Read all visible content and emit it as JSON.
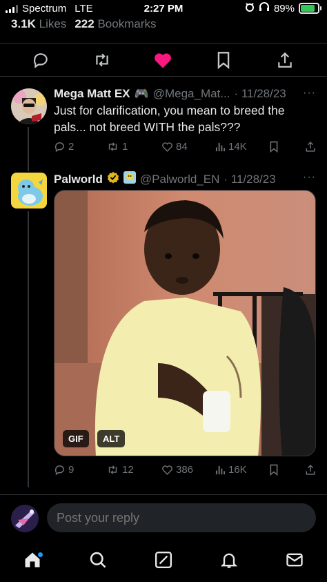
{
  "status_bar": {
    "carrier": "Spectrum",
    "network": "LTE",
    "time": "2:27 PM",
    "battery": "89%"
  },
  "stats": {
    "likes_count": "3.1K",
    "likes_label": "Likes",
    "bookmarks_count": "222",
    "bookmarks_label": "Bookmarks"
  },
  "actions": [
    "reply-icon",
    "retweet-icon",
    "heart-icon",
    "bookmark-icon",
    "share-icon"
  ],
  "accent": {
    "like": "#f91880",
    "link": "#1d9bf0",
    "verified": "#e2b719"
  },
  "tweets": [
    {
      "name": "Mega Matt EX",
      "name_emoji": "🎮",
      "handle": "@Mega_Mat...",
      "date": "· 11/28/23",
      "more": "···",
      "text": "Just for clarification, you mean to breed the pals... not breed WITH the pals???",
      "replies": "2",
      "retweets": "1",
      "likes": "84",
      "views": "14K"
    },
    {
      "name": "Palworld",
      "handle": "@Palworld_EN",
      "date": "· 11/28/23",
      "more": "···",
      "badge_gif": "GIF",
      "badge_alt": "ALT",
      "replies": "9",
      "retweets": "12",
      "likes": "386",
      "views": "16K"
    }
  ],
  "reply": {
    "placeholder": "Post your reply"
  },
  "tab_bar": [
    "home-icon",
    "search-icon",
    "grok-icon",
    "notifications-icon",
    "messages-icon"
  ]
}
